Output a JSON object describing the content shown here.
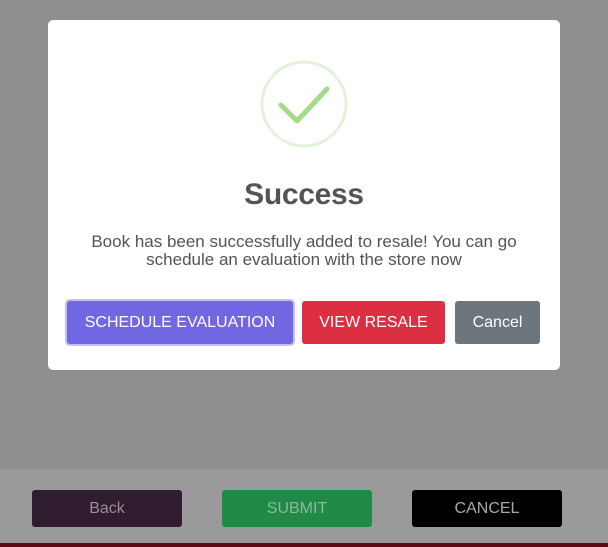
{
  "footer": {
    "back_label": "Back",
    "submit_label": "SUBMIT",
    "cancel_label": "CANCEL"
  },
  "modal": {
    "icon": "checkmark-icon",
    "title": "Success",
    "message": "Book has been successfully added to resale! You can go schedule an evaluation with the store now",
    "buttons": {
      "schedule_label": "SCHEDULE EVALUATION",
      "view_resale_label": "VIEW RESALE",
      "cancel_label": "Cancel"
    }
  },
  "colors": {
    "overlay": "#8f8f8f",
    "success_green": "#a5dc86",
    "primary": "#7267e3",
    "danger": "#dc3042",
    "secondary": "#6d757d"
  }
}
